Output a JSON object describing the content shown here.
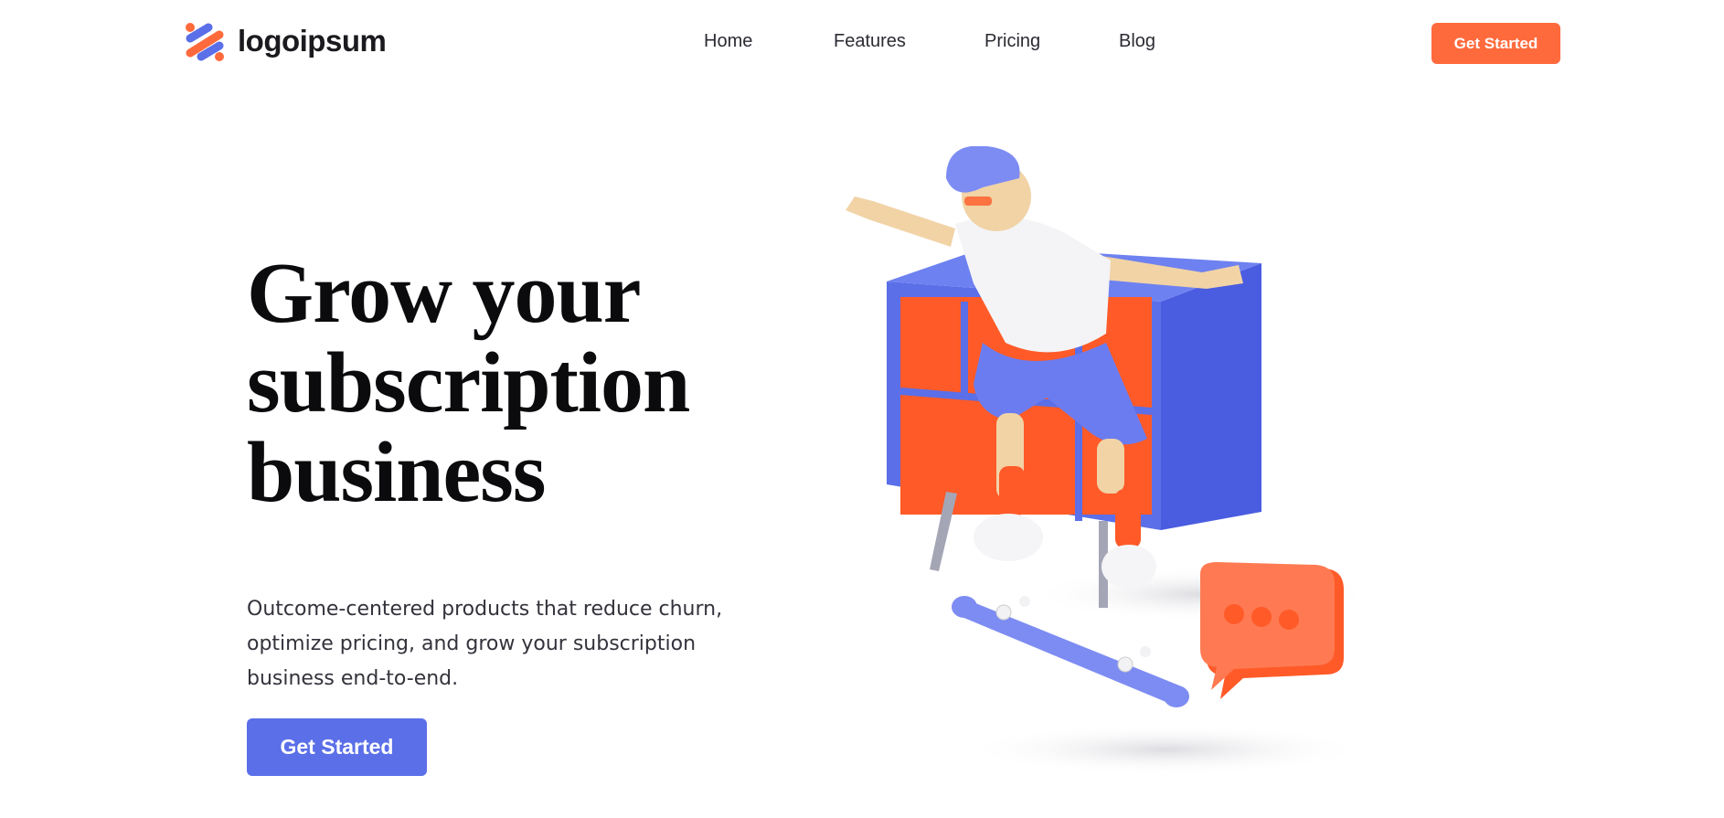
{
  "brand": {
    "name": "logoipsum",
    "colors": {
      "orange": "#ff6a3d",
      "purple": "#5b6fe8"
    }
  },
  "nav": {
    "items": [
      "Home",
      "Features",
      "Pricing",
      "Blog"
    ]
  },
  "header": {
    "cta_label": "Get Started"
  },
  "hero": {
    "title_lines": [
      "Grow your",
      "subscription",
      "business"
    ],
    "subtitle_lines": [
      "Outcome-centered products that reduce churn,",
      "optimize pricing, and grow your subscription",
      "business end-to-end."
    ],
    "cta_label": "Get Started"
  },
  "illustration": {
    "speech_bubble_dots": 3
  }
}
